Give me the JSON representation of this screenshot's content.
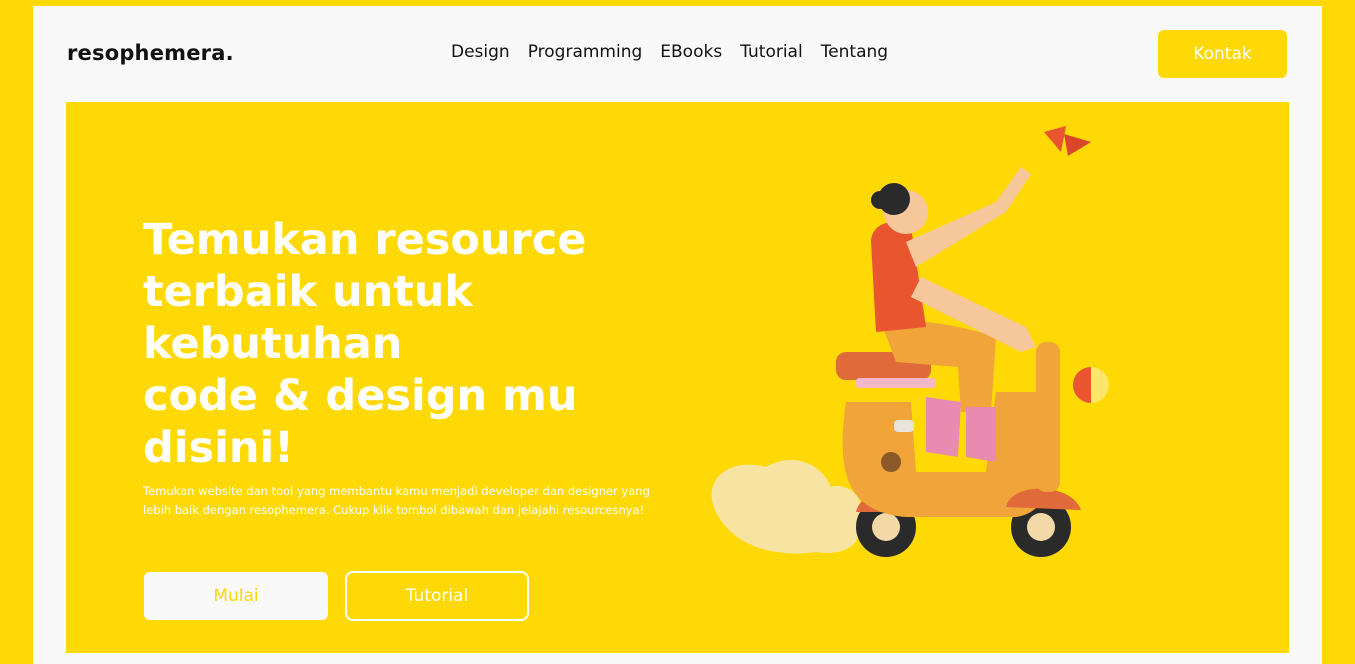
{
  "brand": {
    "name": "resophemera."
  },
  "nav": {
    "items": [
      {
        "label": "Design"
      },
      {
        "label": "Programming"
      },
      {
        "label": "EBooks"
      },
      {
        "label": "Tutorial"
      },
      {
        "label": "Tentang"
      }
    ],
    "cta_label": "Kontak"
  },
  "hero": {
    "title_lines": [
      "Temukan resource",
      "terbaik untuk",
      "kebutuhan",
      "code & design mu",
      "disini!"
    ],
    "description": "Temukan website dan tool yang membantu kamu menjadi developer dan designer yang lebih baik dengan resophemera. Cukup klik tombol dibawah dan jelajahi resourcesnya!",
    "primary_button": "Mulai",
    "secondary_button": "Tutorial",
    "illustration": "woman-riding-scooter-illustration"
  },
  "colors": {
    "accent": "#FFD905",
    "card": "#F9F9F9",
    "text_dark": "#111111",
    "text_light": "#FFFFFF"
  }
}
